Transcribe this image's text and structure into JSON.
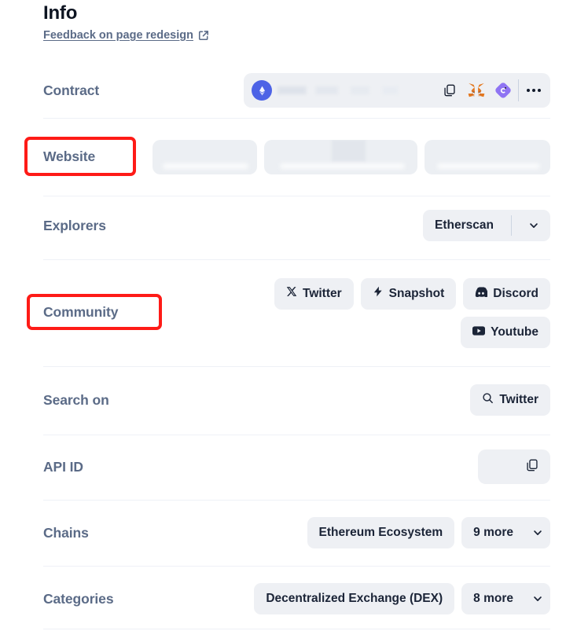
{
  "header": {
    "title": "Info",
    "feedback_link": "Feedback on page redesign",
    "feedback_icon": "external-link-icon"
  },
  "rows": [
    {
      "key": "contract",
      "label": "Contract",
      "value_type": "contract",
      "address_text": "",
      "icons": [
        "ethereum-icon",
        "copy-icon",
        "metamask-fox-icon",
        "wallet-icon",
        "more-options-icon"
      ]
    },
    {
      "key": "website",
      "label": "Website",
      "value_type": "redacted-chips",
      "chips": [
        "",
        "",
        ""
      ],
      "highlighted": true
    },
    {
      "key": "explorers",
      "label": "Explorers",
      "value_type": "dropdown-chip",
      "chips": [
        {
          "label": "Etherscan",
          "caret": true
        }
      ]
    },
    {
      "key": "community",
      "label": "Community",
      "value_type": "chips",
      "highlighted": true,
      "chips": [
        {
          "label": "Twitter",
          "icon": "x-twitter-icon"
        },
        {
          "label": "Snapshot",
          "icon": "lightning-bolt-icon"
        },
        {
          "label": "Discord",
          "icon": "discord-icon"
        },
        {
          "label": "Youtube",
          "icon": "youtube-icon"
        }
      ]
    },
    {
      "key": "search_on",
      "label": "Search on",
      "value_type": "chips",
      "chips": [
        {
          "label": "Twitter",
          "icon": "search-icon"
        }
      ]
    },
    {
      "key": "api_id",
      "label": "API ID",
      "value_type": "copy-chip",
      "api_id_value": "",
      "icon": "copy-icon"
    },
    {
      "key": "chains",
      "label": "Chains",
      "value_type": "chips-with-more",
      "chips": [
        {
          "label": "Ethereum Ecosystem"
        }
      ],
      "more_label": "9 more"
    },
    {
      "key": "categories",
      "label": "Categories",
      "value_type": "chips-with-more",
      "chips": [
        {
          "label": "Decentralized Exchange (DEX)"
        }
      ],
      "more_label": "8 more"
    }
  ],
  "annotations": [
    {
      "target": "website-label",
      "color": "#fe1b17"
    },
    {
      "target": "community-label",
      "color": "#fe1b17"
    }
  ],
  "colors": {
    "label": "#5b6b87",
    "chip_bg": "#eef0f4",
    "chip_text": "#1b2437",
    "separator": "#eef1f6",
    "annotation": "#fe1b17",
    "ethereum": "#4d63e6"
  }
}
